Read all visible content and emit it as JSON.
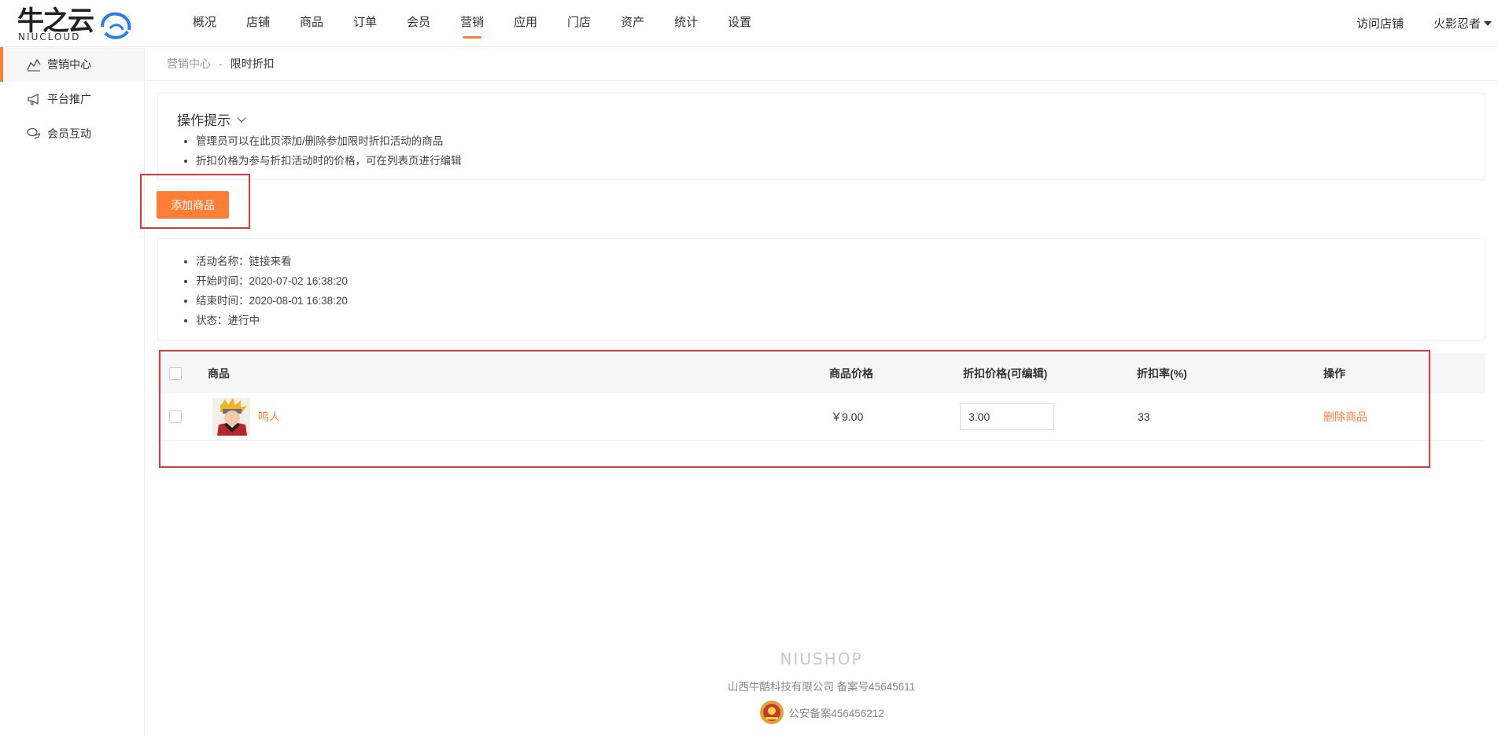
{
  "header": {
    "logo_cn": "牛之云",
    "logo_en": "NIUCLOUD",
    "nav": [
      "概况",
      "店铺",
      "商品",
      "订单",
      "会员",
      "营销",
      "应用",
      "门店",
      "资产",
      "统计",
      "设置"
    ],
    "active_nav": "营销",
    "visit_store": "访问店铺",
    "username": "火影忍者"
  },
  "sidebar": {
    "items": [
      {
        "label": "营销中心",
        "icon": "chart-icon",
        "active": true
      },
      {
        "label": "平台推广",
        "icon": "megaphone-icon",
        "active": false
      },
      {
        "label": "会员互动",
        "icon": "chat-icon",
        "active": false
      }
    ]
  },
  "breadcrumb": {
    "parent": "营销中心",
    "separator": "-",
    "current": "限时折扣"
  },
  "tips": {
    "title": "操作提示",
    "items": [
      "管理员可以在此页添加/删除参加限时折扣活动的商品",
      "折扣价格为参与折扣活动时的价格，可在列表页进行编辑"
    ]
  },
  "add_button": "添加商品",
  "activity": {
    "name": "活动名称：链接来看",
    "start": "开始时间：2020-07-02 16:38:20",
    "end": "结束时间：2020-08-01 16:38:20",
    "status": "状态：进行中"
  },
  "table": {
    "headers": {
      "goods": "商品",
      "price": "商品价格",
      "discount_price": "折扣价格(可编辑)",
      "rate": "折扣率(%)",
      "action": "操作"
    },
    "rows": [
      {
        "name": "鸣人",
        "price": "￥9.00",
        "discount_price": "3.00",
        "rate": "33",
        "action": "删除商品"
      }
    ]
  },
  "footer": {
    "logo": "NIUSHOP",
    "company": "山西牛酷科技有限公司  备案号45645611",
    "police": "公安备案456456212"
  },
  "colors": {
    "accent": "#ff7e37",
    "highlight": "#e8343a"
  }
}
